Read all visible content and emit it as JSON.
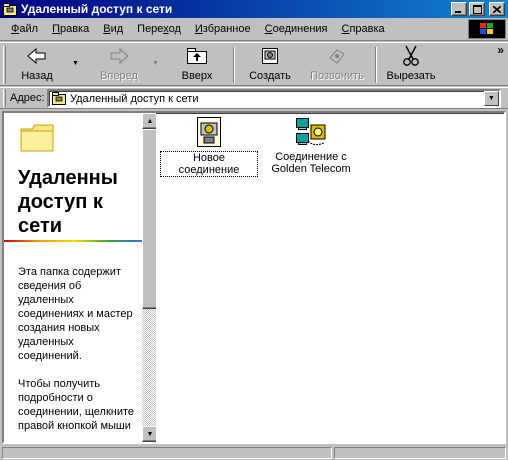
{
  "window": {
    "title": "Удаленный доступ к сети",
    "icon": "dialup-folder-icon"
  },
  "menubar": {
    "items": [
      {
        "label": "Файл",
        "accel": "Ф"
      },
      {
        "label": "Правка",
        "accel": "П"
      },
      {
        "label": "Вид",
        "accel": "В"
      },
      {
        "label": "Переход",
        "accel": "х"
      },
      {
        "label": "Избранное",
        "accel": "И"
      },
      {
        "label": "Соединения",
        "accel": "С"
      },
      {
        "label": "Справка",
        "accel": "С"
      }
    ]
  },
  "toolbar": {
    "back_label": "Назад",
    "forward_label": "Вперед",
    "up_label": "Вверх",
    "create_label": "Создать",
    "dial_label": "Позвонить",
    "cut_label": "Вырезать",
    "more_glyph": "»"
  },
  "address": {
    "label": "Адрес:",
    "value": "Удаленный доступ к сети"
  },
  "left_panel": {
    "title_lines": [
      "Удаленны",
      "доступ к",
      "сети"
    ],
    "paragraphs": [
      "Эта папка содержит сведения об удаленных соединениях и мастер создания новых удаленных соединений.",
      "Чтобы получить подробности о соединении, щелкните правой кнопкой мыши"
    ]
  },
  "files": [
    {
      "name": "Новое соединение",
      "icon": "new-connection-icon",
      "selected": true
    },
    {
      "name": "Соединение с Golden Telecom",
      "icon": "connection-icon",
      "selected": false
    }
  ],
  "colors": {
    "titlebar_start": "#000080",
    "titlebar_end": "#1084d0",
    "face": "#c0c0c0"
  }
}
